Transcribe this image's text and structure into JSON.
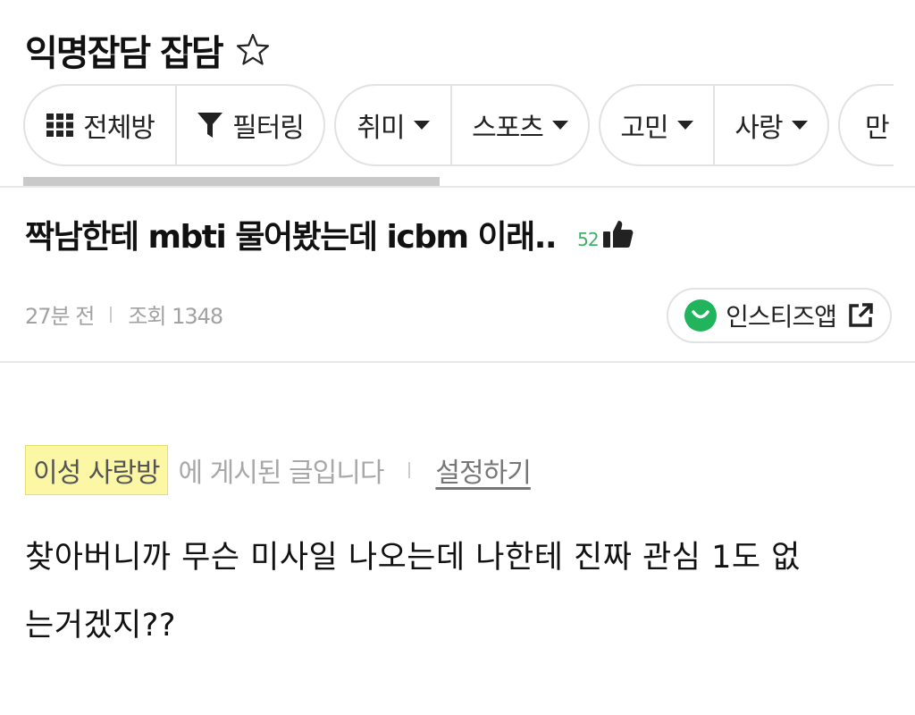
{
  "header": {
    "board_title": "익명잡담 잡담"
  },
  "filters": {
    "all_rooms": "전체방",
    "filtering": "필터링",
    "hobby": "취미",
    "sports": "스포츠",
    "worry": "고민",
    "love": "사랑",
    "partial": "만"
  },
  "post": {
    "title": "짝남한테 mbti 물어봤는데 icbm 이래..",
    "likes": "52",
    "time_ago": "27분 전",
    "views": "조회 1348",
    "app_button": "인스티즈앱",
    "board_tag": "이성 사랑방",
    "board_notice": "에 게시된 글입니다",
    "settings_link": "설정하기",
    "body_line1": "찾아버니까 무슨 미사일 나오는데 나한테 진짜 관심 1도 없",
    "body_line2": "는거겠지??"
  },
  "colors": {
    "accent_green": "#21b45c",
    "like_green": "#3fb067",
    "tag_yellow": "#fbf7a5"
  }
}
